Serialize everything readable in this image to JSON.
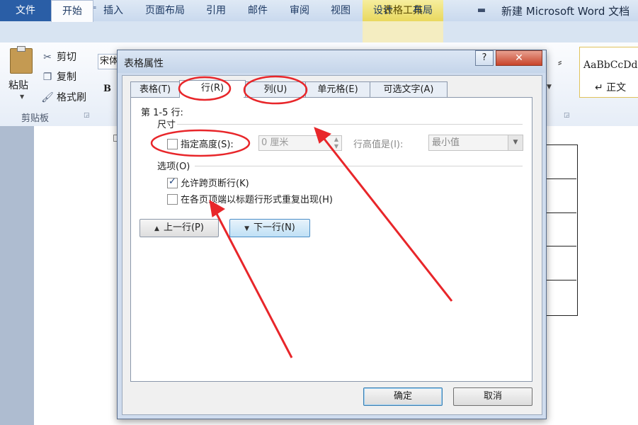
{
  "window": {
    "app_icon": "W",
    "title": "新建 Microsoft Word 文档",
    "context_tab_group": "表格工具"
  },
  "ribbon_tabs": [
    "文件",
    "开始",
    "插入",
    "页面布局",
    "引用",
    "邮件",
    "审阅",
    "视图",
    "设计",
    "布局"
  ],
  "clipboard": {
    "paste": "粘贴",
    "cut": "剪切",
    "copy": "复制",
    "format_painter": "格式刷",
    "group_label": "剪贴板"
  },
  "font": {
    "name": "宋体",
    "bold": "B"
  },
  "styles": {
    "sample": "AaBbCcDd",
    "name": "↵ 正文"
  },
  "dialog": {
    "title": "表格属性",
    "help": "?",
    "close": "✕",
    "tabs": [
      "表格(T)",
      "行(R)",
      "列(U)",
      "单元格(E)",
      "可选文字(A)"
    ],
    "rows_label": "第 1-5 行:",
    "size_section": "尺寸",
    "specify_height_label": "指定高度(S):",
    "specify_height_checked": false,
    "height_value": "0 厘米",
    "row_height_is_label": "行高值是(I):",
    "row_height_is_value": "最小值",
    "options_section": "选项(O)",
    "allow_break_label": "允许跨页断行(K)",
    "allow_break_checked": true,
    "repeat_header_label": "在各页顶端以标题行形式重复出现(H)",
    "repeat_header_checked": false,
    "prev_row": "上一行(P)",
    "next_row": "下一行(N)",
    "ok": "确定",
    "cancel": "取消"
  },
  "colors": {
    "annotation": "#e8262a",
    "file_tab": "#2a5ea6",
    "table_tools": "#e9d85f"
  },
  "icons": {
    "paste": "clipboard-icon",
    "cut": "scissors-icon",
    "copy": "copy-icon",
    "format_painter": "paintbrush-icon",
    "prev": "triangle-up-icon",
    "next": "triangle-down-icon"
  }
}
